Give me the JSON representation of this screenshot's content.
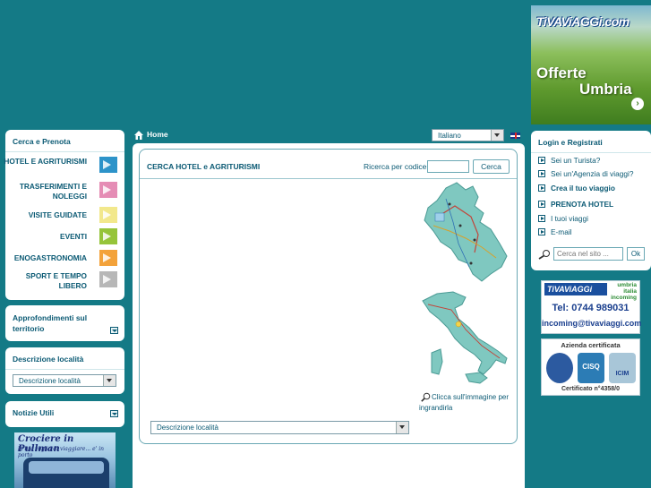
{
  "banner": {
    "brand": "TiVAViAGGi.com",
    "line1": "Offerte",
    "line2": "Umbria",
    "arrow": "›"
  },
  "left": {
    "cerca_title": "Cerca e Prenota",
    "menu": [
      {
        "label": "HOTEL E AGRITURISMI",
        "color": "#2d93c9"
      },
      {
        "label": "TRASFERIMENTI E NOLEGGI",
        "color": "#e58db5"
      },
      {
        "label": "VISITE GUIDATE",
        "color": "#f2e88c"
      },
      {
        "label": "EVENTI",
        "color": "#96c43a"
      },
      {
        "label": "ENOGASTRONOMIA",
        "color": "#f3a23a"
      },
      {
        "label": "SPORT E TEMPO LIBERO",
        "color": "#b7b7b7"
      }
    ],
    "approfondimenti": "Approfondimenti sul territorio",
    "descrizione_title": "Descrizione località",
    "descrizione_select": "Descrizione località",
    "notizie": "Notizie Utili",
    "pullman_title": "Crociere in Pullman",
    "pullman_sub": "la tua voglia di viaggiare... e' in porto"
  },
  "center": {
    "home": "Home",
    "language": "Italiano",
    "title": "CERCA HOTEL e AGRITURISMI",
    "code_label": "Ricerca per codice",
    "code_value": "",
    "search_button": "Cerca",
    "zoom_hint": "Clicca sull'immagine per ingrandirla",
    "localita_select": "Descrizione località"
  },
  "right": {
    "login_title": "Login e Registrati",
    "links": [
      {
        "label": "Sei un Turista?",
        "bold": false
      },
      {
        "label": "Sei un'Agenzia di viaggi?",
        "bold": false
      },
      {
        "label": "Crea il tuo viaggio",
        "bold": true
      },
      {
        "label": "PRENOTA HOTEL",
        "bold": true
      },
      {
        "label": "I tuoi viaggi",
        "bold": false
      },
      {
        "label": "E-mail",
        "bold": false
      }
    ],
    "site_search_placeholder": "Cerca nel sito ...",
    "ok": "Ok",
    "contact_brand": "TiVAViAGGi",
    "contact_region": "umbria italia incoming",
    "contact_tel": "Tel: 0744 989031",
    "contact_mail": "incoming@tivaviaggi.com",
    "cert_title": "Azienda certificata",
    "cert_seal1": "",
    "cert_seal2": "CISQ",
    "cert_seal3": "ICIM",
    "cert_number": "Certificato n°4358/0"
  },
  "colors": {
    "background": "#147a86",
    "text": "#0b5a74",
    "panel": "#ffffff"
  }
}
